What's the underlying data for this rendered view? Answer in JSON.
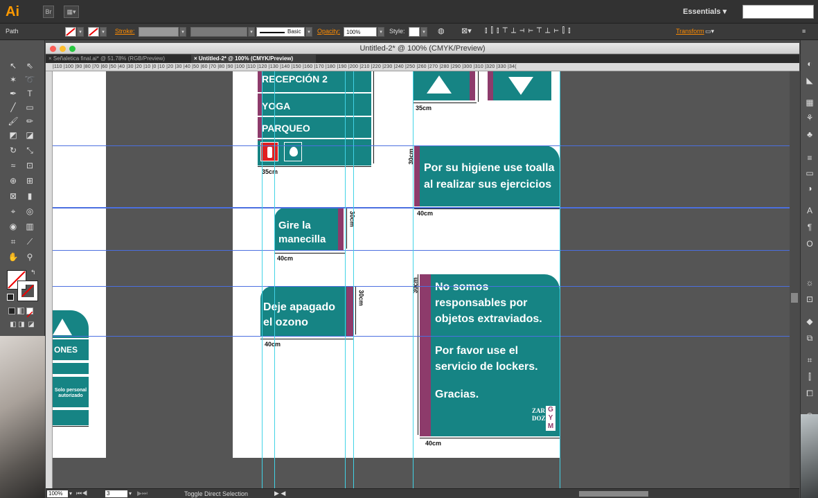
{
  "app": {
    "logo": "Ai",
    "bridge": "Br",
    "workspace": "Essentials",
    "workspace_arrow": "▾"
  },
  "control": {
    "label_path": "Path",
    "stroke_label": "Stroke:",
    "opacity_label": "Opacity:",
    "opacity_value": "100%",
    "style_label": "Style:",
    "brush_label": "Basic",
    "transform_label": "Transform"
  },
  "window": {
    "title": "Untitled-2* @ 100% (CMYK/Preview)"
  },
  "tabs": [
    {
      "label": "× Señaletica final.ai* @ 51.78% (RGB/Preview)"
    },
    {
      "label": "× Untitled-2* @ 100% (CMYK/Preview)"
    }
  ],
  "ruler": {
    "ticks": "|110 |100 |90  |80  |70  |60  |50  |40  |30  |20  |10  |0   |10  |20  |30  |40  |50  |60  |70  |80  |90  |100 |110 |120 |130 |140 |150 |160 |170 |180 |190 |200 |210 |220 |230 |240 |250 |260 |270 |280 |290 |300 |310 |320 |330 |34("
  },
  "signs": {
    "directory": [
      "RECEPCIÓN 2",
      "YOGA",
      "PARQUEO"
    ],
    "towel": [
      "Por su higiene use toalla",
      "al realizar sus ejercicios"
    ],
    "handle": [
      "Gire la",
      "manecilla"
    ],
    "ozone": [
      "Deje apagado",
      "el ozono"
    ],
    "lost": [
      "No somos",
      "responsables por",
      "objetos extraviados.",
      "Por favor use el",
      "servicio de lockers.",
      "Gracias."
    ],
    "left_partial": "ONES",
    "left_staff": [
      "Solo personal",
      "autorizado"
    ],
    "logo_left": "ZAR DOZ",
    "logo_right": "G Y M"
  },
  "dims": {
    "d35a": "35cm",
    "d35b": "35cm",
    "d30a": "30cm",
    "d40a": "40cm",
    "d30b": "30cm",
    "d40b": "40cm",
    "d30c": "30cm",
    "d40c": "40cm",
    "d30d": "30cm",
    "d40d": "40cm"
  },
  "status": {
    "zoom": "100%",
    "page": "3",
    "message": "Toggle Direct Selection"
  },
  "colors": {
    "teal": "#168484",
    "purple": "#8d3b6b",
    "guide_h": "#4b6fe0",
    "guide_v": "#41d3e6"
  }
}
